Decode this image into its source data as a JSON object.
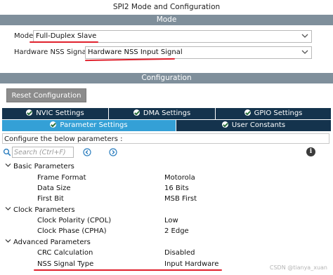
{
  "window": {
    "title": "SPI2 Mode and Configuration"
  },
  "mode_section": {
    "title": "Mode",
    "mode_label": "Mode",
    "mode_value": "Full-Duplex Slave",
    "nss_label": "Hardware NSS Signal",
    "nss_value": "Hardware NSS Input Signal"
  },
  "config_section": {
    "title": "Configuration",
    "reset_button": "Reset Configuration",
    "tabs_row1": [
      {
        "label": "NVIC Settings"
      },
      {
        "label": "DMA Settings"
      },
      {
        "label": "GPIO Settings"
      }
    ],
    "tabs_row2": [
      {
        "label": "Parameter Settings",
        "active": true
      },
      {
        "label": "User Constants",
        "active": false
      }
    ],
    "configure_label": "Configure the below parameters :",
    "search_placeholder": "Search (Ctrl+F)"
  },
  "groups": [
    {
      "title": "Basic Parameters",
      "params": [
        {
          "name": "Frame Format",
          "value": "Motorola"
        },
        {
          "name": "Data Size",
          "value": "16 Bits"
        },
        {
          "name": "First Bit",
          "value": "MSB First"
        }
      ]
    },
    {
      "title": "Clock Parameters",
      "params": [
        {
          "name": "Clock Polarity (CPOL)",
          "value": "Low"
        },
        {
          "name": "Clock Phase (CPHA)",
          "value": "2 Edge"
        }
      ]
    },
    {
      "title": "Advanced Parameters",
      "params": [
        {
          "name": "CRC Calculation",
          "value": "Disabled"
        },
        {
          "name": "NSS Signal Type",
          "value": "Input Hardware"
        }
      ]
    }
  ],
  "colors": {
    "section_bar": "#7f8f9b",
    "tab_dark": "#14334d",
    "tab_active": "#34a0d6",
    "annotation_red": "#e0212d"
  },
  "watermark": "CSDN @tianya_xuan"
}
